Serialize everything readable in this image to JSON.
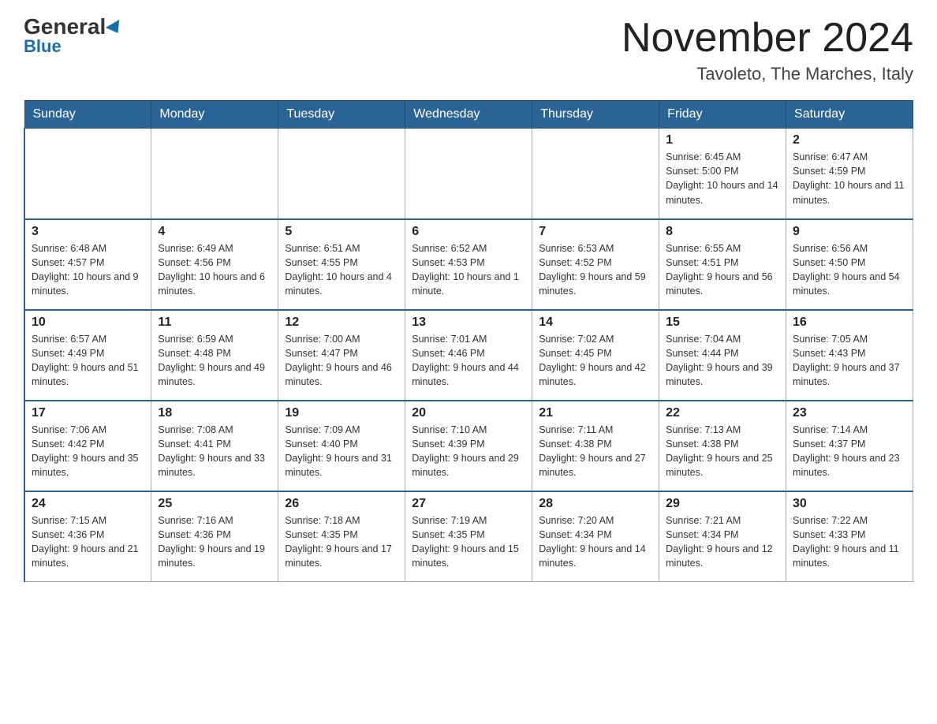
{
  "header": {
    "logo_line1": "General",
    "logo_line2": "Blue",
    "title": "November 2024",
    "subtitle": "Tavoleto, The Marches, Italy"
  },
  "days_of_week": [
    "Sunday",
    "Monday",
    "Tuesday",
    "Wednesday",
    "Thursday",
    "Friday",
    "Saturday"
  ],
  "weeks": [
    [
      {
        "day": "",
        "sunrise": "",
        "sunset": "",
        "daylight": ""
      },
      {
        "day": "",
        "sunrise": "",
        "sunset": "",
        "daylight": ""
      },
      {
        "day": "",
        "sunrise": "",
        "sunset": "",
        "daylight": ""
      },
      {
        "day": "",
        "sunrise": "",
        "sunset": "",
        "daylight": ""
      },
      {
        "day": "",
        "sunrise": "",
        "sunset": "",
        "daylight": ""
      },
      {
        "day": "1",
        "sunrise": "Sunrise: 6:45 AM",
        "sunset": "Sunset: 5:00 PM",
        "daylight": "Daylight: 10 hours and 14 minutes."
      },
      {
        "day": "2",
        "sunrise": "Sunrise: 6:47 AM",
        "sunset": "Sunset: 4:59 PM",
        "daylight": "Daylight: 10 hours and 11 minutes."
      }
    ],
    [
      {
        "day": "3",
        "sunrise": "Sunrise: 6:48 AM",
        "sunset": "Sunset: 4:57 PM",
        "daylight": "Daylight: 10 hours and 9 minutes."
      },
      {
        "day": "4",
        "sunrise": "Sunrise: 6:49 AM",
        "sunset": "Sunset: 4:56 PM",
        "daylight": "Daylight: 10 hours and 6 minutes."
      },
      {
        "day": "5",
        "sunrise": "Sunrise: 6:51 AM",
        "sunset": "Sunset: 4:55 PM",
        "daylight": "Daylight: 10 hours and 4 minutes."
      },
      {
        "day": "6",
        "sunrise": "Sunrise: 6:52 AM",
        "sunset": "Sunset: 4:53 PM",
        "daylight": "Daylight: 10 hours and 1 minute."
      },
      {
        "day": "7",
        "sunrise": "Sunrise: 6:53 AM",
        "sunset": "Sunset: 4:52 PM",
        "daylight": "Daylight: 9 hours and 59 minutes."
      },
      {
        "day": "8",
        "sunrise": "Sunrise: 6:55 AM",
        "sunset": "Sunset: 4:51 PM",
        "daylight": "Daylight: 9 hours and 56 minutes."
      },
      {
        "day": "9",
        "sunrise": "Sunrise: 6:56 AM",
        "sunset": "Sunset: 4:50 PM",
        "daylight": "Daylight: 9 hours and 54 minutes."
      }
    ],
    [
      {
        "day": "10",
        "sunrise": "Sunrise: 6:57 AM",
        "sunset": "Sunset: 4:49 PM",
        "daylight": "Daylight: 9 hours and 51 minutes."
      },
      {
        "day": "11",
        "sunrise": "Sunrise: 6:59 AM",
        "sunset": "Sunset: 4:48 PM",
        "daylight": "Daylight: 9 hours and 49 minutes."
      },
      {
        "day": "12",
        "sunrise": "Sunrise: 7:00 AM",
        "sunset": "Sunset: 4:47 PM",
        "daylight": "Daylight: 9 hours and 46 minutes."
      },
      {
        "day": "13",
        "sunrise": "Sunrise: 7:01 AM",
        "sunset": "Sunset: 4:46 PM",
        "daylight": "Daylight: 9 hours and 44 minutes."
      },
      {
        "day": "14",
        "sunrise": "Sunrise: 7:02 AM",
        "sunset": "Sunset: 4:45 PM",
        "daylight": "Daylight: 9 hours and 42 minutes."
      },
      {
        "day": "15",
        "sunrise": "Sunrise: 7:04 AM",
        "sunset": "Sunset: 4:44 PM",
        "daylight": "Daylight: 9 hours and 39 minutes."
      },
      {
        "day": "16",
        "sunrise": "Sunrise: 7:05 AM",
        "sunset": "Sunset: 4:43 PM",
        "daylight": "Daylight: 9 hours and 37 minutes."
      }
    ],
    [
      {
        "day": "17",
        "sunrise": "Sunrise: 7:06 AM",
        "sunset": "Sunset: 4:42 PM",
        "daylight": "Daylight: 9 hours and 35 minutes."
      },
      {
        "day": "18",
        "sunrise": "Sunrise: 7:08 AM",
        "sunset": "Sunset: 4:41 PM",
        "daylight": "Daylight: 9 hours and 33 minutes."
      },
      {
        "day": "19",
        "sunrise": "Sunrise: 7:09 AM",
        "sunset": "Sunset: 4:40 PM",
        "daylight": "Daylight: 9 hours and 31 minutes."
      },
      {
        "day": "20",
        "sunrise": "Sunrise: 7:10 AM",
        "sunset": "Sunset: 4:39 PM",
        "daylight": "Daylight: 9 hours and 29 minutes."
      },
      {
        "day": "21",
        "sunrise": "Sunrise: 7:11 AM",
        "sunset": "Sunset: 4:38 PM",
        "daylight": "Daylight: 9 hours and 27 minutes."
      },
      {
        "day": "22",
        "sunrise": "Sunrise: 7:13 AM",
        "sunset": "Sunset: 4:38 PM",
        "daylight": "Daylight: 9 hours and 25 minutes."
      },
      {
        "day": "23",
        "sunrise": "Sunrise: 7:14 AM",
        "sunset": "Sunset: 4:37 PM",
        "daylight": "Daylight: 9 hours and 23 minutes."
      }
    ],
    [
      {
        "day": "24",
        "sunrise": "Sunrise: 7:15 AM",
        "sunset": "Sunset: 4:36 PM",
        "daylight": "Daylight: 9 hours and 21 minutes."
      },
      {
        "day": "25",
        "sunrise": "Sunrise: 7:16 AM",
        "sunset": "Sunset: 4:36 PM",
        "daylight": "Daylight: 9 hours and 19 minutes."
      },
      {
        "day": "26",
        "sunrise": "Sunrise: 7:18 AM",
        "sunset": "Sunset: 4:35 PM",
        "daylight": "Daylight: 9 hours and 17 minutes."
      },
      {
        "day": "27",
        "sunrise": "Sunrise: 7:19 AM",
        "sunset": "Sunset: 4:35 PM",
        "daylight": "Daylight: 9 hours and 15 minutes."
      },
      {
        "day": "28",
        "sunrise": "Sunrise: 7:20 AM",
        "sunset": "Sunset: 4:34 PM",
        "daylight": "Daylight: 9 hours and 14 minutes."
      },
      {
        "day": "29",
        "sunrise": "Sunrise: 7:21 AM",
        "sunset": "Sunset: 4:34 PM",
        "daylight": "Daylight: 9 hours and 12 minutes."
      },
      {
        "day": "30",
        "sunrise": "Sunrise: 7:22 AM",
        "sunset": "Sunset: 4:33 PM",
        "daylight": "Daylight: 9 hours and 11 minutes."
      }
    ]
  ]
}
